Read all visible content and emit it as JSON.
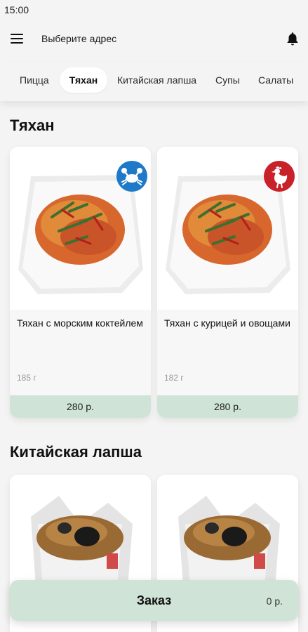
{
  "status_bar": {
    "time": "15:00"
  },
  "header": {
    "address": "Выберите адрес"
  },
  "tabs": [
    {
      "label": "Пицца"
    },
    {
      "label": "Тяхан"
    },
    {
      "label": "Китайская лапша"
    },
    {
      "label": "Супы"
    },
    {
      "label": "Салаты"
    }
  ],
  "active_tab": "Тяхан",
  "sections": [
    {
      "title": "Тяхан",
      "items": [
        {
          "name": "Тяхан с морским коктейлем",
          "weight": "185 г",
          "price": "280 р.",
          "badge_icon": "crab-icon",
          "badge_color": "#1e79c8"
        },
        {
          "name": "Тяхан с курицей и овощами",
          "weight": "182 г",
          "price": "280 р.",
          "badge_icon": "chicken-icon",
          "badge_color": "#c9212a"
        }
      ]
    },
    {
      "title": "Китайская лапша"
    }
  ],
  "order_bar": {
    "label": "Заказ",
    "total": "0 р."
  },
  "colors": {
    "accent_green": "#cfe3d6",
    "background": "#f4f4f4"
  }
}
